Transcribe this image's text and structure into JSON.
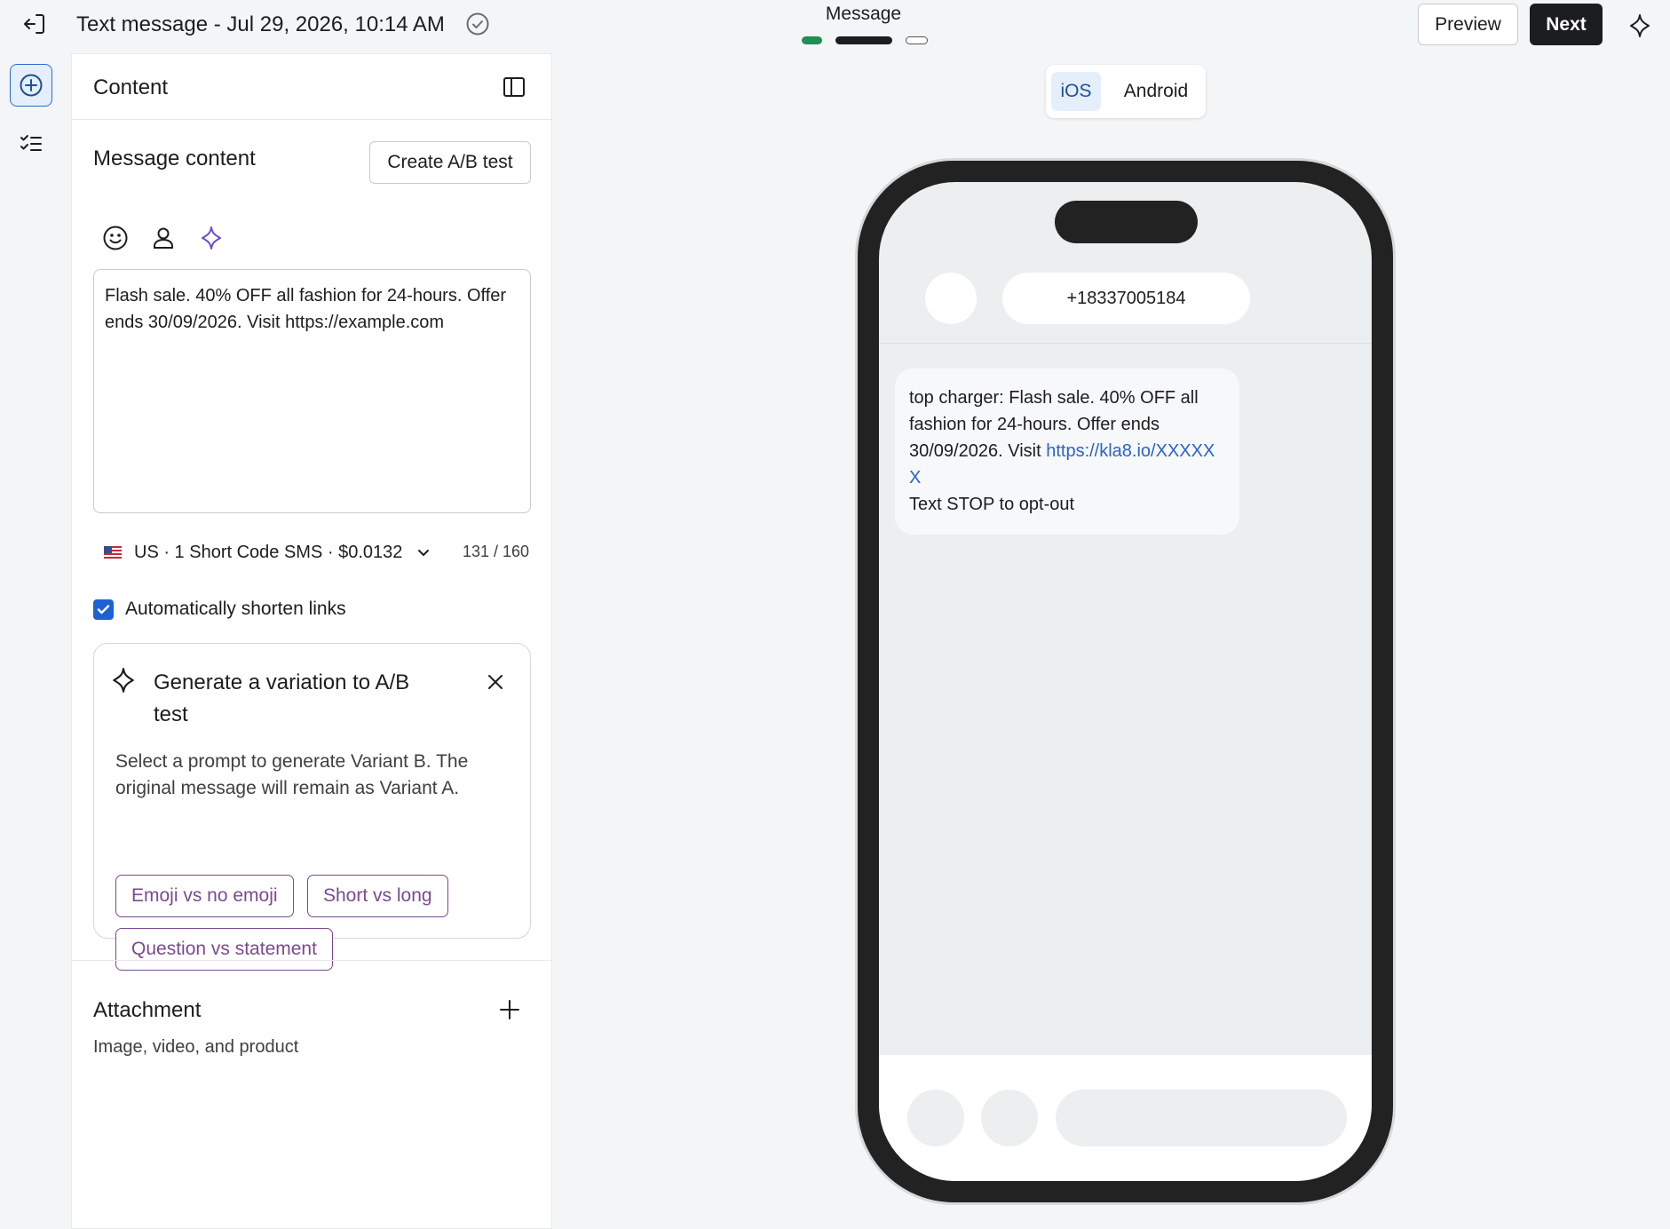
{
  "topbar": {
    "title": "Text message - Jul 29, 2026, 10:14 AM",
    "step_label": "Message",
    "preview_label": "Preview",
    "next_label": "Next"
  },
  "panel": {
    "title": "Content",
    "section_title": "Message content",
    "ab_button": "Create A/B test",
    "message_text": "Flash sale. 40% OFF all fashion for 24-hours. Offer ends 30/09/2026. Visit https://example.com",
    "sender": "US · 1 Short Code SMS · $0.0132",
    "char_count": "131 / 160",
    "shorten_label": "Automatically shorten links",
    "shorten_checked": true
  },
  "ai_card": {
    "title": "Generate a variation to A/B test",
    "description": "Select a prompt to generate Variant B. The original message will remain as Variant A.",
    "chips": [
      "Emoji vs no emoji",
      "Short vs long",
      "Question vs statement"
    ]
  },
  "attachment": {
    "title": "Attachment",
    "subtitle": "Image, video, and product"
  },
  "preview": {
    "os_options": [
      "iOS",
      "Android"
    ],
    "os_selected": "iOS",
    "phone_number": "+18337005184",
    "bubble": {
      "text_before_link": "top charger: Flash sale. 40% OFF all fashion for 24-hours. Offer ends 30/09/2026. Visit ",
      "link": "https://kla8.io/XXXXXX",
      "opt_out": "Text STOP to opt-out"
    }
  },
  "icons": {
    "exit": "exit-icon",
    "saved": "check-circle-icon",
    "ai": "sparkle-icon",
    "add_content": "plus-circle-icon",
    "checklist": "checklist-icon",
    "sidebar_toggle": "sidebar-toggle-icon",
    "emoji": "emoji-icon",
    "personalize": "person-icon",
    "close": "close-icon",
    "add": "plus-icon",
    "flag": "us-flag-icon",
    "chevron": "chevron-down-icon"
  },
  "colors": {
    "accent_blue": "#1d61d4",
    "step_done": "#1f8f55",
    "chip_purple": "#7a4a8f",
    "link_blue": "#2b63c7",
    "primary_dark": "#1c1d1f"
  }
}
